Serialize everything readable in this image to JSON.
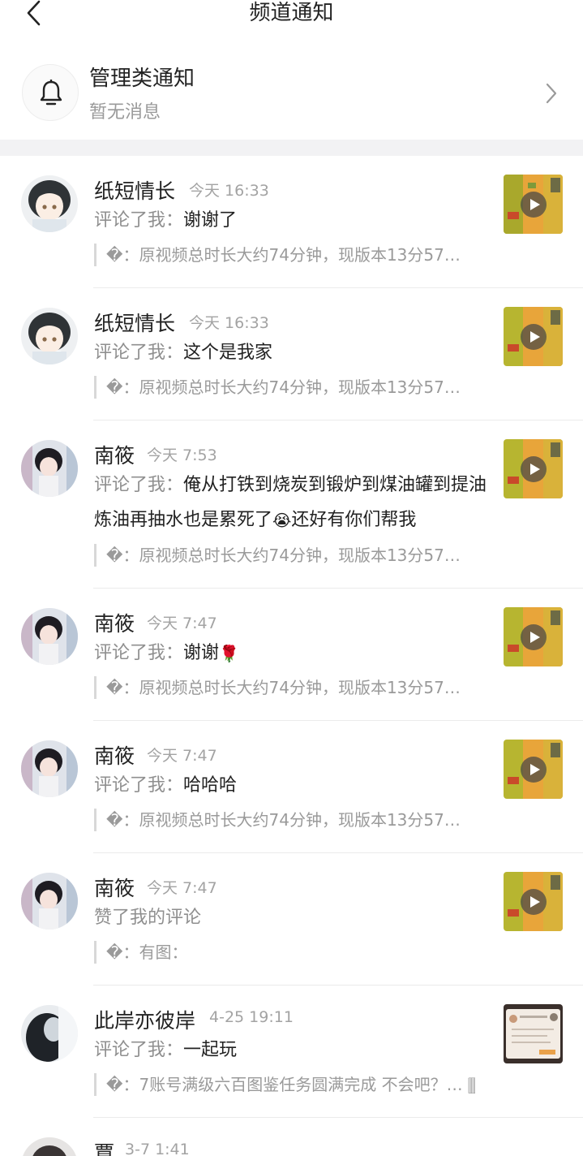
{
  "header": {
    "title": "频道通知"
  },
  "management": {
    "title": "管理类通知",
    "subtitle": "暂无消息"
  },
  "notifications": [
    {
      "name": "纸短情长",
      "time": "今天 16:33",
      "action_label": "评论了我：",
      "comment": "谢谢了",
      "quote": "�：原视频总时长大约74分钟，现版本13分57…",
      "avatar": "avatar-anime-white-hair",
      "thumbnail": "game-map-video"
    },
    {
      "name": "纸短情长",
      "time": "今天 16:33",
      "action_label": "评论了我：",
      "comment": "这个是我家",
      "quote": "�：原视频总时长大约74分钟，现版本13分57…",
      "avatar": "avatar-anime-white-hair",
      "thumbnail": "game-map-video"
    },
    {
      "name": "南筱",
      "time": "今天 7:53",
      "action_label": "评论了我：",
      "comment": "俺从打铁到烧炭到锻炉到煤油罐到提油炼油再抽水也是累死了",
      "comment_tail": "还好有你们帮我",
      "emoji": "😭",
      "quote": "�：原视频总时长大约74分钟，现版本13分57…",
      "avatar": "avatar-anime-dark-hair",
      "thumbnail": "game-map-video"
    },
    {
      "name": "南筱",
      "time": "今天 7:47",
      "action_label": "评论了我：",
      "comment": "谢谢",
      "emoji": "🌹",
      "quote": "�：原视频总时长大约74分钟，现版本13分57…",
      "avatar": "avatar-anime-dark-hair",
      "thumbnail": "game-map-video"
    },
    {
      "name": "南筱",
      "time": "今天 7:47",
      "action_label": "评论了我：",
      "comment": "哈哈哈",
      "quote": "�：原视频总时长大约74分钟，现版本13分57…",
      "avatar": "avatar-anime-dark-hair",
      "thumbnail": "game-map-video"
    },
    {
      "name": "南筱",
      "time": "今天 7:47",
      "action_label": "赞了我的评论",
      "comment": "",
      "quote": "�：有图：",
      "avatar": "avatar-anime-dark-hair",
      "thumbnail": "game-map-video"
    },
    {
      "name": "此岸亦彼岸",
      "time": "4-25 19:11",
      "action_label": "评论了我：",
      "comment": "一起玩",
      "quote": "�：7账号满级六百图鉴任务圆满完成 不会吧？… 🀫",
      "avatar": "avatar-dark-figure",
      "thumbnail": "screenshot-image"
    },
    {
      "name": "覃",
      "time": "3-7 1:41",
      "avatar": "avatar-partial"
    }
  ],
  "colors": {
    "accent_text": "#222222",
    "muted_text": "#9a9a9a",
    "divider": "#f2f2f4"
  }
}
